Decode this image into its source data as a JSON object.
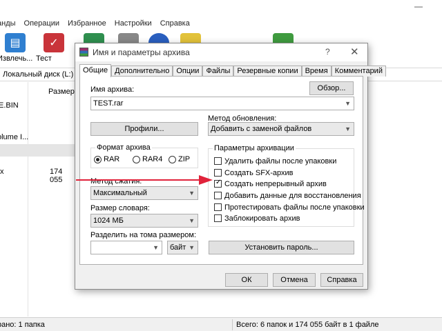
{
  "menu": [
    "анды",
    "Операции",
    "Избранное",
    "Настройки",
    "Справка"
  ],
  "window": {
    "minimize_glyph": "—"
  },
  "toolbar": {
    "extract_label": "Извлечь...",
    "test_label": "Тест"
  },
  "address_bar": {
    "path": "Локальный диск (L:)"
  },
  "filelist": {
    "size_header": "Размер",
    "rows": [
      {
        "name": "E.BIN",
        "size": ""
      },
      {
        "name": "olume I...",
        "size": ""
      },
      {
        "name": "x",
        "size": "174 055"
      }
    ]
  },
  "status": {
    "left": "рано: 1 папка",
    "right": "Всего: 6 папок и 174 055 байт в 1 файле"
  },
  "dialog": {
    "title": "Имя и параметры архива",
    "help_glyph": "?",
    "close_glyph": "✕",
    "tabs": [
      "Общие",
      "Дополнительно",
      "Опции",
      "Файлы",
      "Резервные копии",
      "Время",
      "Комментарий"
    ],
    "archive_name_label": "Имя архива:",
    "archive_name_value": "TEST.rar",
    "browse_label": "Обзор...",
    "update_method_label": "Метод обновления:",
    "update_method_value": "Добавить с заменой файлов",
    "profiles_label": "Профили...",
    "format_group_label": "Формат архива",
    "formats": [
      {
        "label": "RAR",
        "selected": true
      },
      {
        "label": "RAR4",
        "selected": false
      },
      {
        "label": "ZIP",
        "selected": false
      }
    ],
    "compression_label": "Метод сжатия:",
    "compression_value": "Максимальный",
    "dictionary_label": "Размер словаря:",
    "dictionary_value": "1024 МБ",
    "split_label": "Разделить на тома размером:",
    "split_value": "",
    "split_unit": "байт",
    "options_group_label": "Параметры архивации",
    "options": [
      {
        "label": "Удалить файлы после упаковки",
        "checked": false
      },
      {
        "label": "Создать SFX-архив",
        "checked": false
      },
      {
        "label": "Создать непрерывный архив",
        "checked": true
      },
      {
        "label": "Добавить данные для восстановления",
        "checked": false
      },
      {
        "label": "Протестировать файлы после упаковки",
        "checked": false
      },
      {
        "label": "Заблокировать архив",
        "checked": false
      }
    ],
    "password_label": "Установить пароль...",
    "ok_label": "ОК",
    "cancel_label": "Отмена",
    "help_label": "Справка"
  },
  "colors": {
    "annotation_arrow": "#e0223a",
    "extract_icon": "#2f7fd0",
    "test_icon": "#c9343a"
  }
}
